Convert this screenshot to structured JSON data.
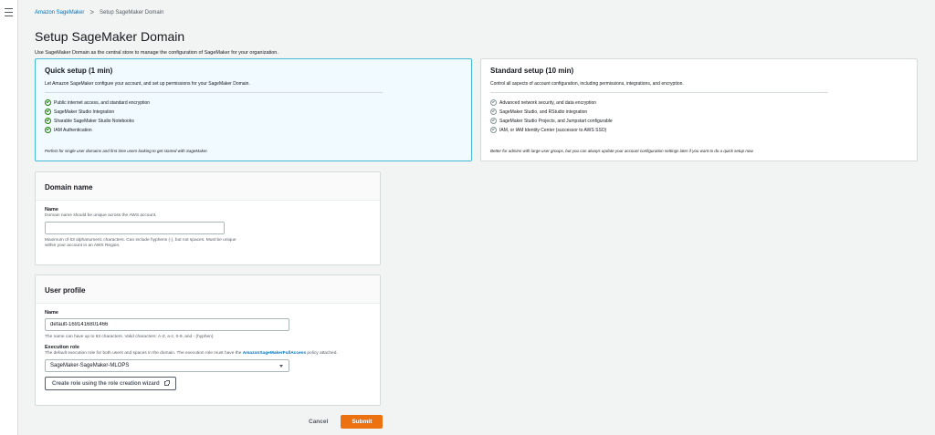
{
  "nav": {
    "menu_icon": "hamburger-menu-icon"
  },
  "breadcrumb": {
    "items": [
      {
        "label": "Amazon SageMaker"
      },
      {
        "label": "Setup SageMaker Domain"
      }
    ],
    "separator": ">"
  },
  "page": {
    "title": "Setup SageMaker Domain",
    "description": "Use SageMaker Domain as the central store to manage the configuration of SageMaker for your organization."
  },
  "setup_options": {
    "quick": {
      "title": "Quick setup (1 min)",
      "description": "Let Amazon SageMaker configure your account, and set up permissions for your SageMaker Domain.",
      "features": [
        "Public internet access, and standard encryption",
        "SageMaker Studio Integration",
        "Sharable SageMaker Studio Notebooks",
        "IAM Authentication"
      ],
      "footer": "Perfect for single user domains and first time users looking to get started with SageMaker.",
      "selected": true
    },
    "standard": {
      "title": "Standard setup (10 min)",
      "description": "Control all aspects of account configuration, including permissions, integrations, and encryption.",
      "features": [
        "Advanced network security, and data encryption",
        "SageMaker Studio, and RStudio integration",
        "SageMaker Studio Projects, and Jumpstart configurable",
        "IAM, or IAM Identity Center (successor to AWS SSO)"
      ],
      "footer": "Better for admins with large user groups, but you can always update your account configuration settings later if you want to do a quick setup now.",
      "selected": false
    }
  },
  "domain_name": {
    "header": "Domain name",
    "label": "Name",
    "description": "Domain name should be unique across the AWS account.",
    "value": "",
    "constraint_line1": "Maximum of 63 alphanumeric characters. Can include hyphens (-), but not spaces. Must be unique",
    "constraint_line2": "within your account in an AWS Region."
  },
  "user_profile": {
    "header": "User profile",
    "name_label": "Name",
    "name_value": "default-1691416801466",
    "name_constraint": "The name can have up to 63 characters. Valid characters: A-Z, a-z, 0-9, and - (hyphen)",
    "role_label": "Execution role",
    "role_desc_prefix": "The default execution role for both users and spaces in the domain. The execution role must have the ",
    "role_desc_link": "AmazonSageMakerFullAccess",
    "role_desc_suffix": " policy attached.",
    "role_value": "SageMaker-SageMaker-MLOPS",
    "wizard_button": "Create role using the role creation wizard"
  },
  "actions": {
    "cancel": "Cancel",
    "submit": "Submit"
  },
  "colors": {
    "accent": "#ec7211",
    "link": "#0073bb",
    "selected_tile_bg": "#f1faff",
    "check": "#1d8102"
  }
}
